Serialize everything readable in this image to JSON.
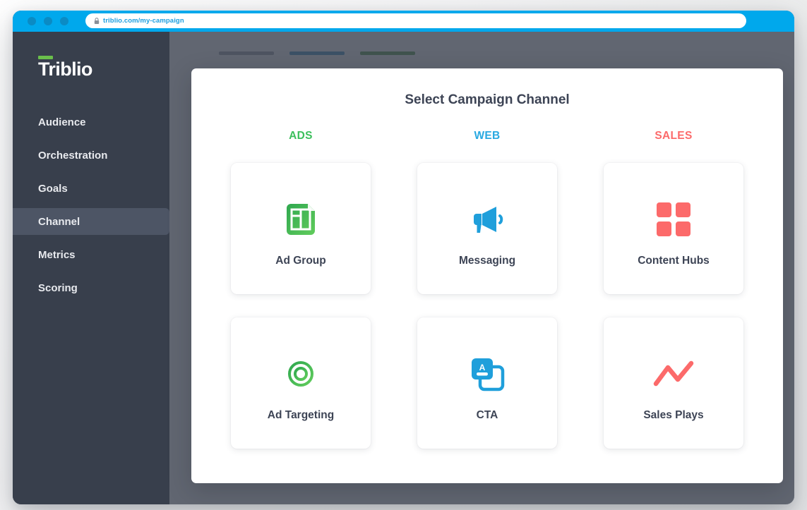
{
  "browser": {
    "url": "triblio.com/my-campaign",
    "lock_icon": "lock-icon",
    "traffic_lights": [
      "close-dot",
      "minimize-dot",
      "maximize-dot"
    ]
  },
  "sidebar": {
    "logo": "Triblio",
    "logo_accent_color": "#6abf4b",
    "items": [
      {
        "label": "Audience",
        "active": false
      },
      {
        "label": "Orchestration",
        "active": false
      },
      {
        "label": "Goals",
        "active": false
      },
      {
        "label": "Channel",
        "active": true
      },
      {
        "label": "Metrics",
        "active": false
      },
      {
        "label": "Scoring",
        "active": false
      }
    ]
  },
  "modal": {
    "title": "Select Campaign Channel",
    "columns": [
      {
        "label": "ADS",
        "color": "#3cbf5c"
      },
      {
        "label": "WEB",
        "color": "#29a9e1"
      },
      {
        "label": "SALES",
        "color": "#fc6a6a"
      }
    ],
    "cards": [
      {
        "label": "Ad Group",
        "icon": "ad-group-icon",
        "color": "#3cbf5c"
      },
      {
        "label": "Messaging",
        "icon": "megaphone-icon",
        "color": "#29a9e1"
      },
      {
        "label": "Content Hubs",
        "icon": "grid-squares-icon",
        "color": "#fc6a6a"
      },
      {
        "label": "Ad Targeting",
        "icon": "crosshair-icon",
        "color": "#3cbf5c"
      },
      {
        "label": "CTA",
        "icon": "cards-stack-icon",
        "color": "#29a9e1"
      },
      {
        "label": "Sales Plays",
        "icon": "trend-line-icon",
        "color": "#fc6a6a"
      }
    ]
  },
  "background_page": {
    "tabs": [
      {
        "color": "#9aa0ac"
      },
      {
        "color": "#4a90c4"
      },
      {
        "color": "#5c9a56"
      }
    ]
  }
}
